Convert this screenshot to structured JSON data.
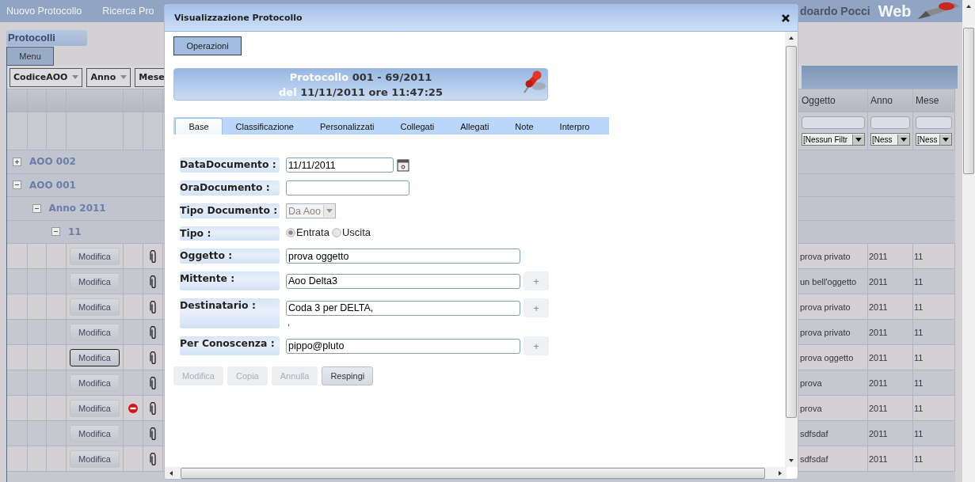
{
  "top_bar": {
    "links": [
      "Nuovo Protocollo",
      "Ricerca Pro"
    ],
    "user": "doardo Pocci",
    "brand": "Web"
  },
  "panel": {
    "title": "Protocolli",
    "menu": "Menu"
  },
  "group_by": [
    "CodiceAOO",
    "Anno",
    "Mese"
  ],
  "columns": [
    "Oggetto",
    "Anno",
    "Mese"
  ],
  "filters": [
    "[Nessun Filtr",
    "[Ness",
    "[Ness"
  ],
  "groups": [
    {
      "label": "AOO 002",
      "expanded": false
    },
    {
      "label": "AOO 001",
      "expanded": true,
      "children": [
        {
          "label": "Anno 2011",
          "expanded": true,
          "children": [
            {
              "label": "11",
              "expanded": true
            }
          ]
        }
      ]
    }
  ],
  "rows": [
    {
      "action": "Modifica",
      "focused": false,
      "blocked": false,
      "attachment": true,
      "oggetto": "prova privato",
      "anno": "2011",
      "mese": "11"
    },
    {
      "action": "Modifica",
      "focused": false,
      "blocked": false,
      "attachment": true,
      "oggetto": "un bell'oggetto",
      "anno": "2011",
      "mese": "11"
    },
    {
      "action": "Modifica",
      "focused": false,
      "blocked": false,
      "attachment": true,
      "oggetto": "prova privato",
      "anno": "2011",
      "mese": "11"
    },
    {
      "action": "Modifica",
      "focused": false,
      "blocked": false,
      "attachment": true,
      "oggetto": "prova privato",
      "anno": "2011",
      "mese": "11"
    },
    {
      "action": "Modifica",
      "focused": true,
      "blocked": false,
      "attachment": true,
      "oggetto": "prova oggetto",
      "anno": "2011",
      "mese": "11"
    },
    {
      "action": "Modifica",
      "focused": false,
      "blocked": false,
      "attachment": true,
      "oggetto": "prova",
      "anno": "2011",
      "mese": "11"
    },
    {
      "action": "Modifica",
      "focused": false,
      "blocked": true,
      "attachment": true,
      "oggetto": "prova",
      "anno": "2011",
      "mese": "11"
    },
    {
      "action": "Modifica",
      "focused": false,
      "blocked": false,
      "attachment": true,
      "oggetto": "sdfsdaf",
      "anno": "2011",
      "mese": "11"
    },
    {
      "action": "Modifica",
      "focused": false,
      "blocked": false,
      "attachment": true,
      "oggetto": "sdfsdaf",
      "anno": "2011",
      "mese": "11"
    }
  ],
  "dialog": {
    "title": "Visualizzazione Protocollo",
    "operations": "Operazioni",
    "header": {
      "label_1": "Protocollo",
      "value_1": "001 - 69/2011",
      "label_2": "del",
      "value_2": "11/11/2011 ore 11:47:25"
    },
    "tabs": [
      {
        "label": "Base",
        "selected": true
      },
      {
        "label": "Classificazione",
        "selected": false
      },
      {
        "label": "Personalizzati",
        "selected": false
      },
      {
        "label": "Collegati",
        "selected": false
      },
      {
        "label": "Allegati",
        "selected": false
      },
      {
        "label": "Note",
        "selected": false
      },
      {
        "label": "Interpro",
        "selected": false
      }
    ],
    "fields": [
      {
        "label": "DataDocumento :",
        "kind": "date",
        "value": "11/11/2011"
      },
      {
        "label": "OraDocumento :",
        "kind": "short"
      },
      {
        "label": "Tipo Documento :",
        "kind": "select",
        "value": "Da Aoo",
        "disabled": true
      },
      {
        "label": "Tipo :",
        "kind": "radio",
        "options": [
          {
            "label": "Entrata",
            "selected": true
          },
          {
            "label": "Uscita",
            "selected": false
          }
        ]
      },
      {
        "label": "Oggetto :",
        "kind": "text",
        "value": "prova oggetto"
      },
      {
        "label": "Mittente :",
        "kind": "text",
        "value": "Aoo Delta3",
        "add": {
          "label": "+",
          "disabled": true
        }
      },
      {
        "label": "Destinatario :",
        "kind": "text",
        "value": "Coda 3 per DELTA,",
        "extra": ",",
        "add": {
          "label": "+",
          "disabled": true
        }
      },
      {
        "label": "Per Conoscenza :",
        "kind": "text",
        "value": "pippo@pluto",
        "add": {
          "label": "+",
          "disabled": true
        }
      }
    ],
    "buttons": [
      {
        "label": "Modifica",
        "disabled": true
      },
      {
        "label": "Copia",
        "disabled": true
      },
      {
        "label": "Annulla",
        "disabled": true
      },
      {
        "label": "Respingi",
        "disabled": false
      }
    ]
  }
}
